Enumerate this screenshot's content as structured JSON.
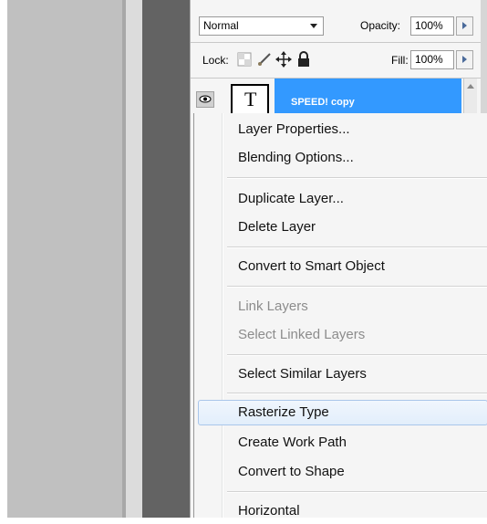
{
  "layers_panel": {
    "blend_mode": "Normal",
    "opacity_label": "Opacity:",
    "opacity_value": "100%",
    "lock_label": "Lock:",
    "fill_label": "Fill:",
    "fill_value": "100%",
    "lock_icons": [
      "lock-transparent-icon",
      "lock-brush-icon",
      "lock-move-icon",
      "lock-all-icon"
    ],
    "layer": {
      "name": "SPEED! copy",
      "thumbnail_glyph": "T",
      "selected_color": "#3399ff"
    }
  },
  "context_menu": {
    "items": [
      {
        "label": "Layer Properties...",
        "enabled": true
      },
      {
        "label": "Blending Options...",
        "enabled": true
      },
      {
        "label": "Duplicate Layer...",
        "enabled": true
      },
      {
        "label": "Delete Layer",
        "enabled": true
      },
      {
        "label": "Convert to Smart Object",
        "enabled": true
      },
      {
        "label": "Link Layers",
        "enabled": false
      },
      {
        "label": "Select Linked Layers",
        "enabled": false
      },
      {
        "label": "Select Similar Layers",
        "enabled": true
      },
      {
        "label": "Rasterize Type",
        "enabled": true,
        "highlighted": true
      },
      {
        "label": "Create Work Path",
        "enabled": true
      },
      {
        "label": "Convert to Shape",
        "enabled": true
      },
      {
        "label": "Horizontal",
        "enabled": true
      }
    ]
  }
}
